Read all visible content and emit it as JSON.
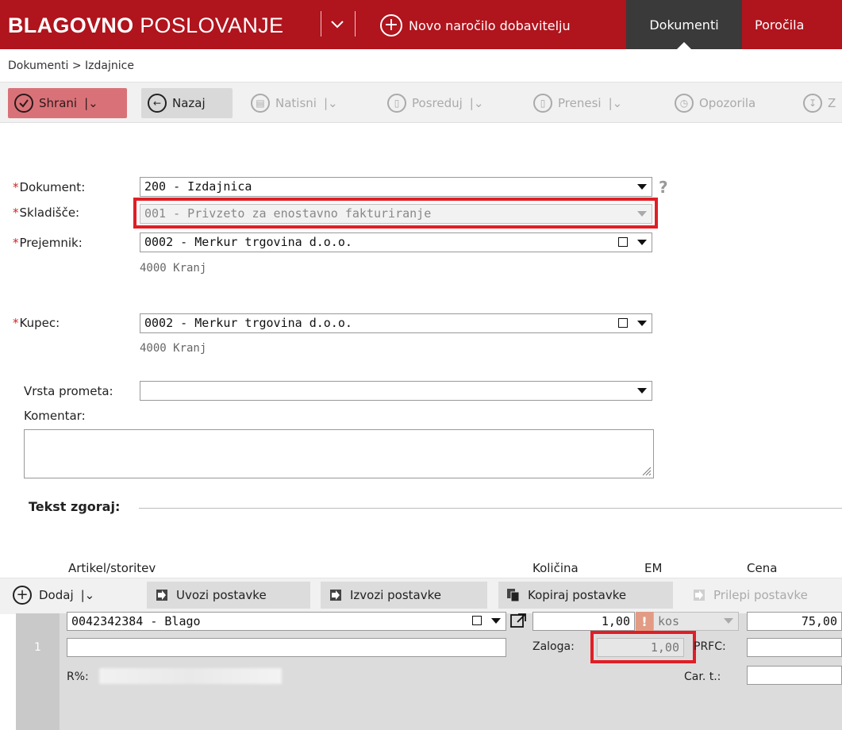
{
  "header": {
    "brand_bold": "BLAGOVNO",
    "brand_light": "POSLOVANJE",
    "new_order_label": "Novo naročilo dobavitelju",
    "tabs": [
      {
        "label": "Dokumenti",
        "active": true
      },
      {
        "label": "Poročila",
        "active": false
      }
    ],
    "bg_color": "#b0141d",
    "active_tab_color": "#3a3a3a"
  },
  "breadcrumb": "Dokumenti > Izdajnice",
  "toolbar": {
    "save": "Shrani",
    "back": "Nazaj",
    "print": "Natisni",
    "forward": "Posreduj",
    "transfer": "Prenesi",
    "reminders": "Opozorila",
    "more": "Z"
  },
  "form": {
    "document": {
      "label": "Dokument:",
      "value": "200 - Izdajnica"
    },
    "warehouse": {
      "label": "Skladišče:",
      "value": "001 - Privzeto za enostavno fakturiranje"
    },
    "recipient": {
      "label": "Prejemnik:",
      "value": "0002 - Merkur trgovina d.o.o.",
      "city": "4000 Kranj"
    },
    "buyer": {
      "label": "Kupec:",
      "value": "0002 - Merkur trgovina d.o.o.",
      "city": "4000 Kranj"
    },
    "traffic_type": {
      "label": "Vrsta prometa:",
      "value": ""
    },
    "comment": {
      "label": "Komentar:",
      "value": ""
    },
    "text_top": "Tekst zgoraj:",
    "help": "?"
  },
  "items_toolbar": {
    "add": "Dodaj",
    "import": "Uvozi postavke",
    "export": "Izvozi postavke",
    "copy": "Kopiraj postavke",
    "paste": "Prilepi postavke"
  },
  "columns": {
    "article": "Artikel/storitev",
    "quantity": "Količina",
    "unit": "EM",
    "price": "Cena"
  },
  "row": {
    "number": "1",
    "article": "0042342384 - Blago",
    "quantity": "1,00",
    "warning": "!",
    "unit": "kos",
    "price": "75,00",
    "stock_label": "Zaloga:",
    "stock_value": "1,00",
    "prfc_label": "PRFC:",
    "rabat_label": "R%:",
    "customs_label": "Car. t.:"
  },
  "colors": {
    "highlight": "#e01e26",
    "save_button": "#d97278"
  }
}
